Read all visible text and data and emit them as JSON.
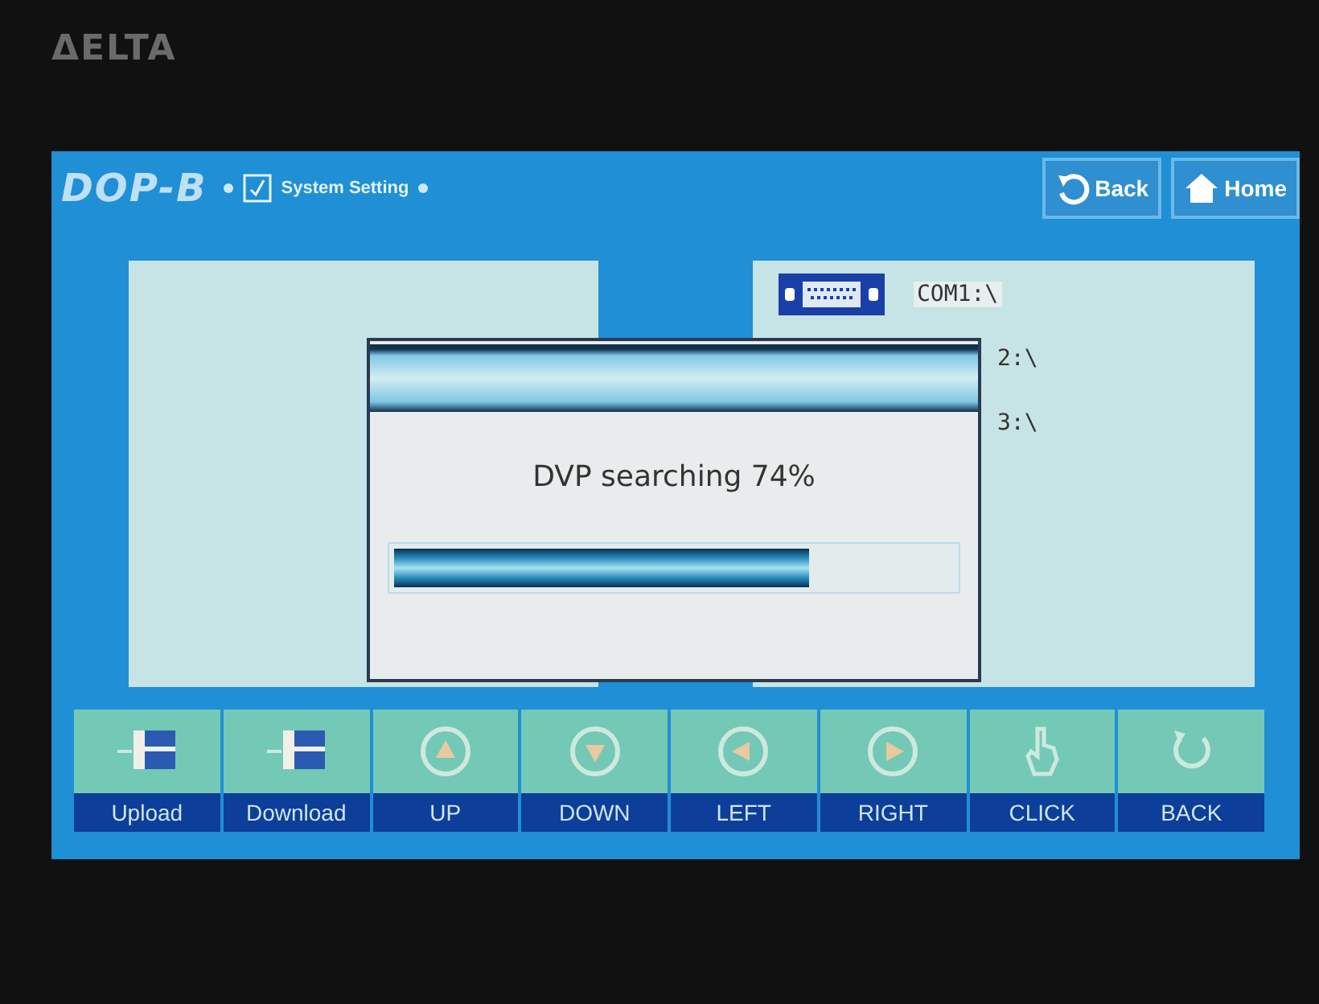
{
  "bezel": {
    "brand": "ΔELTA"
  },
  "header": {
    "logo": "DOP-B",
    "title": "System Setting",
    "buttons": [
      {
        "kind": "back",
        "label": "Back"
      },
      {
        "kind": "home",
        "label": "Home"
      }
    ]
  },
  "ports": [
    {
      "kind": "port",
      "label": "COM1:\\"
    },
    {
      "kind": "partial",
      "label": "2:\\"
    },
    {
      "kind": "partial",
      "label": "3:\\"
    }
  ],
  "dialog": {
    "message": "DVP searching 74%",
    "level": 0.74
  },
  "toolbar": [
    {
      "kind": "upload",
      "label": "Upload"
    },
    {
      "kind": "download",
      "label": "Download"
    },
    {
      "kind": "up",
      "label": "UP"
    },
    {
      "kind": "down",
      "label": "DOWN"
    },
    {
      "kind": "left",
      "label": "LEFT"
    },
    {
      "kind": "right",
      "label": "RIGHT"
    },
    {
      "kind": "click",
      "label": "CLICK"
    },
    {
      "kind": "back",
      "label": "BACK"
    }
  ]
}
